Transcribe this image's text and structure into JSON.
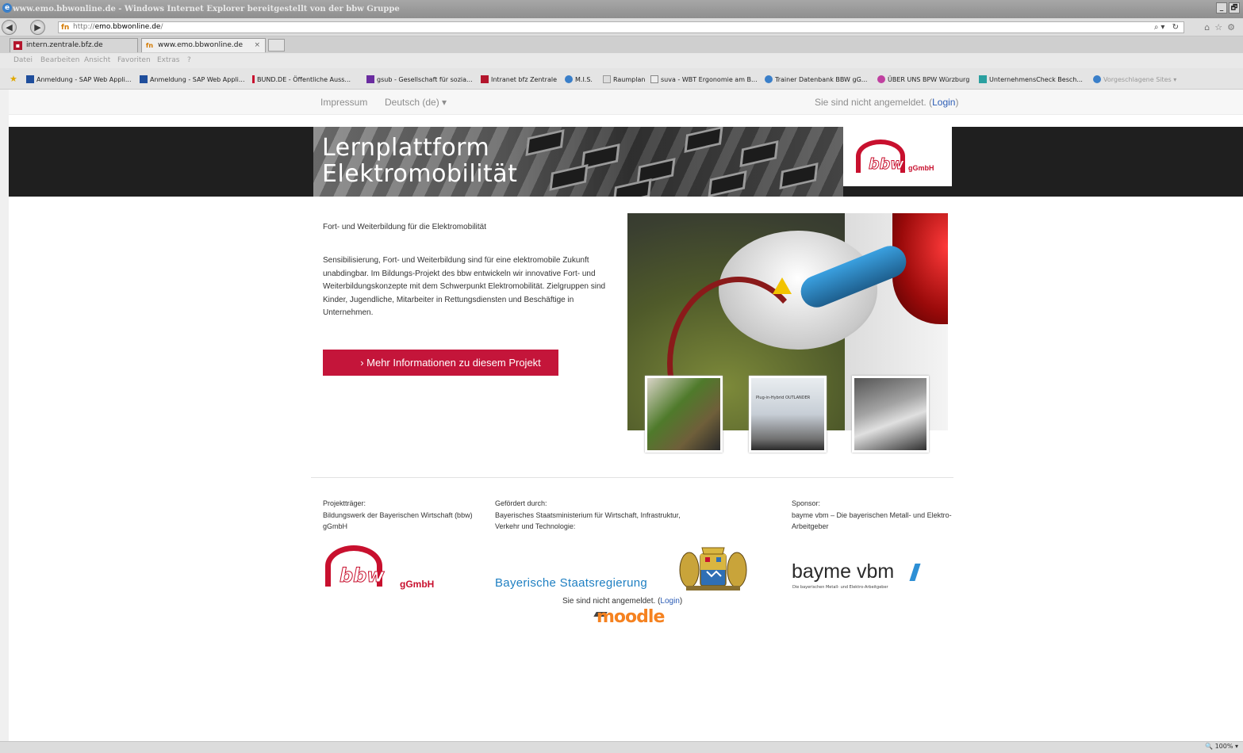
{
  "browser": {
    "window_title": "www.emo.bbwonline.de - Windows Internet Explorer bereitgestellt von der bbw Gruppe",
    "window_buttons": [
      "_",
      "🗗",
      "×"
    ],
    "url_proto": "http://",
    "url_host": "emo.bbwonline.de",
    "url_rest": "/",
    "url_tools": "⌕▾ ↻",
    "right_icons": "⌂☆⚙",
    "tabs": [
      {
        "label": "intern.zentrale.bfz.de",
        "icon": "bfz-icon"
      },
      {
        "label": "www.emo.bbwonline.de",
        "icon": "bbw-favicon",
        "close": "×"
      }
    ],
    "menu": [
      "Datei",
      "Bearbeiten",
      "Ansicht",
      "Favoriten",
      "Extras",
      "?"
    ],
    "favorites": [
      "Anmeldung - SAP Web Appli...",
      "Anmeldung - SAP Web Appli...",
      "BUND.DE - Öffentliche Auss...",
      "gsub - Gesellschaft für sozia...",
      "Intranet bfz Zentrale",
      "M.I.S.",
      "Raumplan",
      "suva - WBT Ergonomie am B...",
      "Trainer Datenbank BBW gG...",
      "ÜBER UNS BPW Würzburg",
      "UnternehmensCheck Besch...",
      "Vorgeschlagene Sites ▾"
    ],
    "zoom": "🔍 100% ▾"
  },
  "topnav": {
    "impressum": "Impressum",
    "language": "Deutsch (de) ▾",
    "login_prefix": "Sie sind nicht angemeldet. (",
    "login_link": "Login",
    "login_suffix": ")"
  },
  "banner": {
    "title_line1": "Lernplattform",
    "title_line2": "Elektromobilität",
    "logo_word": "bbw",
    "logo_sub": "gGmbH"
  },
  "main": {
    "intro_title": "Fort- und Weiterbildung für die Elektromobilität",
    "intro_text": "Sensibilisierung, Fort- und Weiterbildung sind für eine elektromobile Zukunft unabdingbar. Im Bildungs-Projekt des bbw entwickeln wir innovative Fort- und Weiterbildungskonzepte mit dem Schwerpunkt Elektromobilität. Zielgruppen sind Kinder, Jugendliche, Mitarbeiter in Rettungsdiensten und Beschäftige in Unternehmen.",
    "cta_label": "› Mehr Informationen zu diesem Projekt",
    "thumb_label": "Plug-in-Hybrid OUTLANDER"
  },
  "footer": {
    "col1_heading": "Projektträger:",
    "col1_text": "Bildungswerk der Bayerischen Wirtschaft (bbw) gGmbH",
    "col2_heading": "Gefördert durch:",
    "col2_text": "Bayerisches Staatsministerium für Wirtschaft, Infrastruktur, Verkehr und Technologie:",
    "col3_heading": "Sponsor:",
    "col3_text": "bayme vbm – Die bayerischen Metall- und Elektro-Arbeitgeber",
    "bbw_logo_word": "bbw",
    "bbw_logo_sub": "gGmbH",
    "bay_logo_text": "Bayerische Staatsregierung",
    "bayme_logo_text": "bayme vbm",
    "bayme_logo_sub": "Die bayerischen Metall- und Elektro-Arbeitgeber",
    "login_prefix": "Sie sind nicht angemeldet. (",
    "login_link": "Login",
    "login_suffix": ")",
    "moodle_logo": "moodle"
  },
  "colors": {
    "brand_red": "#c4153a",
    "link_blue": "#2a5bb5",
    "banner_bg": "#1f1f1f",
    "bavaria_blue": "#1e7fc2"
  }
}
